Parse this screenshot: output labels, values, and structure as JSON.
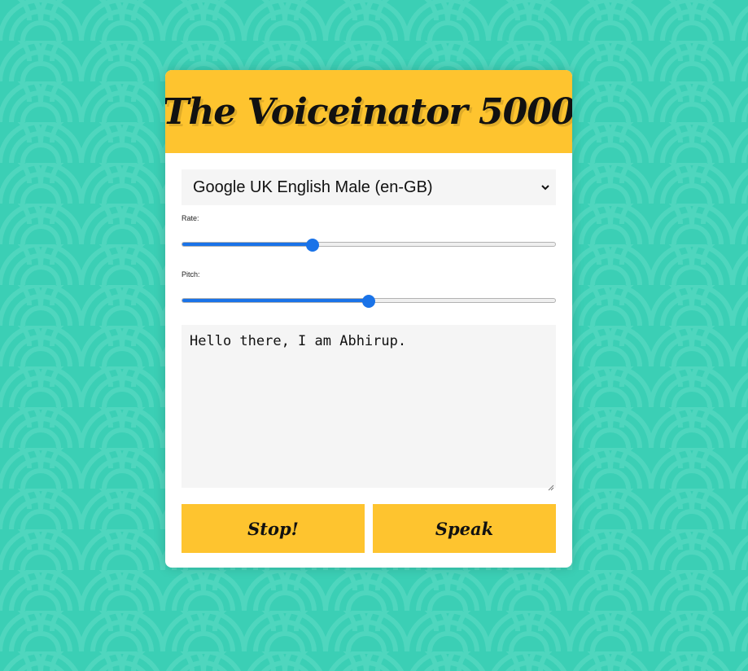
{
  "app": {
    "title": "The Voiceinator 5000"
  },
  "voice_select": {
    "selected": "Google UK English Male (en-GB)"
  },
  "rate": {
    "label": "Rate:",
    "value_fraction": 0.345
  },
  "pitch": {
    "label": "Pitch:",
    "value_fraction": 0.5
  },
  "message": {
    "text": "Hello there, I am Abhirup."
  },
  "buttons": {
    "stop_label": "Stop!",
    "speak_label": "Speak"
  },
  "colors": {
    "background": "#3bcfb5",
    "accent": "#fec42f",
    "slider": "#1a73e8"
  },
  "icons": {
    "select_arrow": "chevron-down-icon",
    "resize": "resize-grip-icon"
  }
}
